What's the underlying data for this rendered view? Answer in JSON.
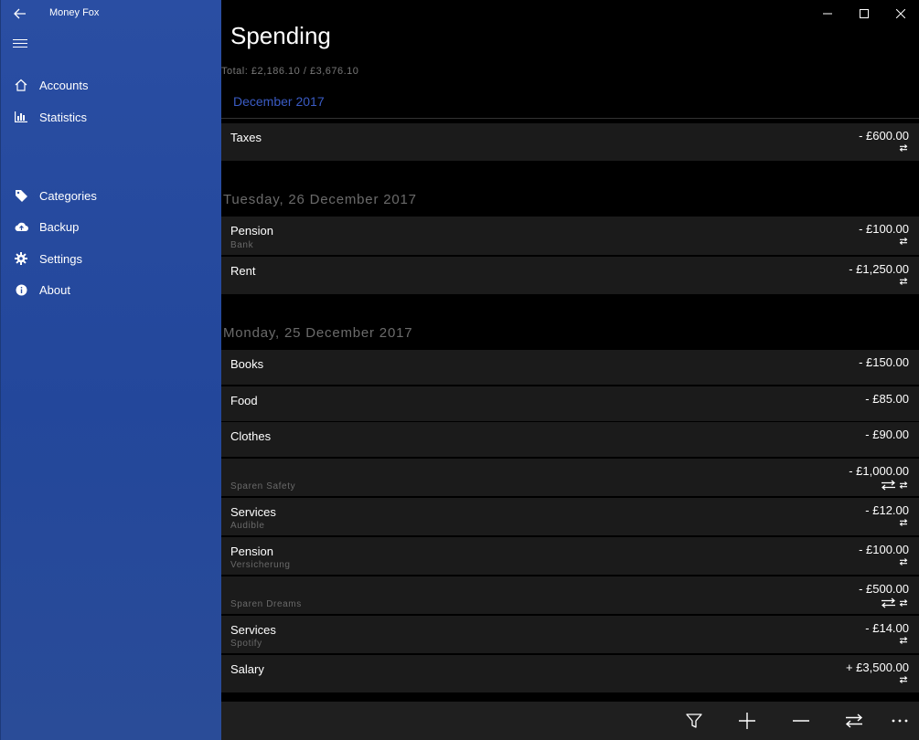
{
  "app": {
    "title": "Money Fox"
  },
  "sidebar": {
    "items": [
      {
        "label": "Accounts",
        "icon": "home-icon"
      },
      {
        "label": "Statistics",
        "icon": "bar-chart-icon"
      },
      {
        "label": "Categories",
        "icon": "tag-icon"
      },
      {
        "label": "Backup",
        "icon": "cloud-upload-icon"
      },
      {
        "label": "Settings",
        "icon": "gear-icon"
      },
      {
        "label": "About",
        "icon": "info-icon"
      }
    ]
  },
  "page": {
    "title": "Spending",
    "totals": "Total: £2,186.10  / £3,676.10",
    "month": "December 2017"
  },
  "groups": [
    {
      "date": "",
      "rows": [
        {
          "title": "Taxes",
          "subtitle": "",
          "amount": "- £600.00",
          "icon": "recurring-icon"
        }
      ]
    },
    {
      "date": "Tuesday, 26 December 2017",
      "rows": [
        {
          "title": "Pension",
          "subtitle": "Bank",
          "amount": "- £100.00",
          "icon": "recurring-icon"
        },
        {
          "title": "Rent",
          "subtitle": "",
          "amount": "- £1,250.00",
          "icon": "recurring-icon"
        }
      ]
    },
    {
      "date": "Monday, 25 December 2017",
      "rows": [
        {
          "title": "Books",
          "subtitle": "",
          "amount": "- £150.00",
          "icon": ""
        },
        {
          "title": "Food",
          "subtitle": "",
          "amount": "- £85.00",
          "icon": ""
        },
        {
          "title": "Clothes",
          "subtitle": "",
          "amount": "- £90.00",
          "icon": ""
        },
        {
          "title": "",
          "subtitle": "Sparen Safety",
          "amount": "- £1,000.00",
          "icon": "transfer-recurring-icon"
        },
        {
          "title": "Services",
          "subtitle": "Audible",
          "amount": "- £12.00",
          "icon": "recurring-icon"
        },
        {
          "title": "Pension",
          "subtitle": "Versicherung",
          "amount": "- £100.00",
          "icon": "recurring-icon"
        },
        {
          "title": "",
          "subtitle": "Sparen Dreams",
          "amount": "- £500.00",
          "icon": "transfer-recurring-icon"
        },
        {
          "title": "Services",
          "subtitle": "Spotify",
          "amount": "- £14.00",
          "icon": "recurring-icon"
        },
        {
          "title": "Salary",
          "subtitle": "",
          "amount": "+ £3,500.00",
          "icon": "recurring-icon"
        }
      ]
    }
  ],
  "bottom_bar": {
    "buttons": [
      "filter-icon",
      "add-icon",
      "remove-icon",
      "transfer-icon",
      "more-icon"
    ]
  }
}
